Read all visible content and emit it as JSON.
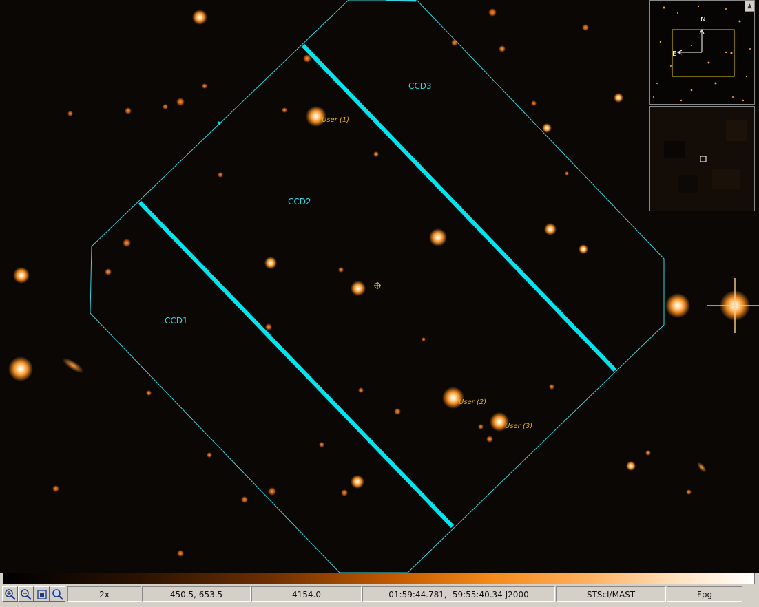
{
  "image": {
    "ccd_labels": [
      "CCD1",
      "CCD2",
      "CCD3"
    ],
    "user_targets": [
      "User (1)",
      "User (2)",
      "User (3)"
    ]
  },
  "compass": {
    "north": "N",
    "east": "E"
  },
  "status": {
    "zoom": "2x",
    "pixel_coords": "450.5, 653.5",
    "pixel_value": "4154.0",
    "world_coords": "01:59:44.781, -59:55:40.34 J2000",
    "source": "STScI/MAST",
    "mode": "Fpg"
  },
  "toolbar": {
    "icons": [
      "zoom-in-icon",
      "zoom-out-icon",
      "zoom-fit-icon",
      "magnify-icon"
    ]
  },
  "colors": {
    "footprint": "#33d5e0",
    "target_label": "#e8b400",
    "background": "#0b0705"
  }
}
